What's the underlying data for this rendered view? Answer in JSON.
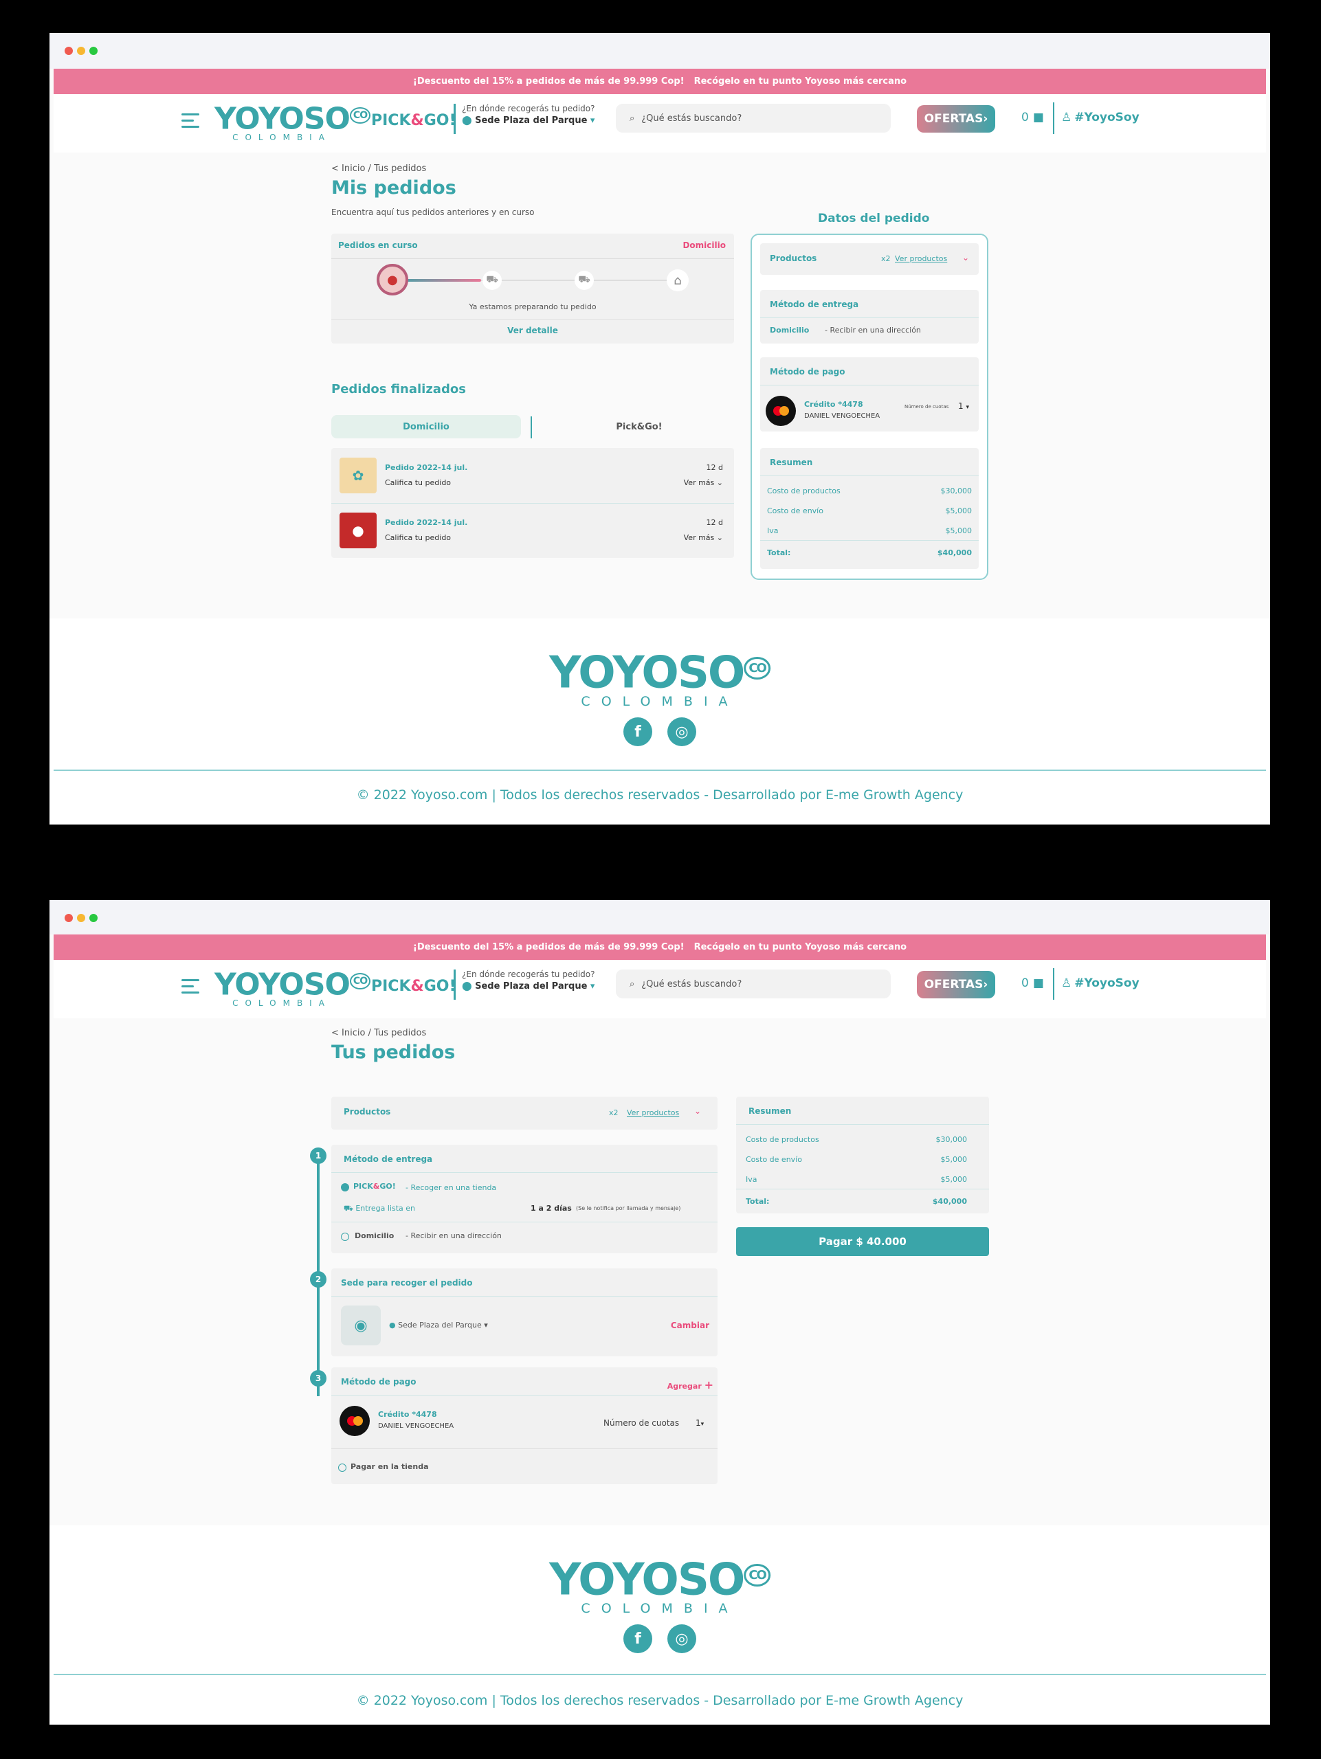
{
  "header": {
    "promo1": "¡Descuento del 15% a pedidos de más de 99.999 Cop!",
    "promo2": "Recógelo en tu punto Yoyoso más cercano",
    "logo_word": "YOYOSO",
    "logo_co": "CO",
    "logo_country": "COLOMBIA",
    "pick": "PICK",
    "amp": "&",
    "go": "GO!",
    "where_q": "¿En dónde recogerás tu pedido?",
    "where_store": "Sede Plaza del Parque",
    "search_placeholder": "¿Qué estás buscando?",
    "ofertas": "OFERTAS",
    "cart_count": "0",
    "user": "#YoyoSoy"
  },
  "screen1": {
    "breadcrumb": "< Inicio / Tus pedidos",
    "title": "Mis pedidos",
    "subtitle": "Encuentra aquí tus pedidos anteriores y en curso",
    "current": {
      "label": "Pedidos en curso",
      "type": "Domicilio",
      "status": "Ya estamos preparando tu pedido",
      "detail": "Ver detalle"
    },
    "finished_title": "Pedidos finalizados",
    "tab_home": "Domicilio",
    "tab_pick": "Pick&Go!",
    "orders": [
      {
        "name": "Pedido 2022-14 jul.",
        "rate": "Califica tu pedido",
        "days": "12 d",
        "more": "Ver más"
      },
      {
        "name": "Pedido 2022-14 jul.",
        "rate": "Califica tu pedido",
        "days": "12 d",
        "more": "Ver más"
      }
    ],
    "panel": {
      "title": "Datos del pedido",
      "products": "Productos",
      "qty": "x2",
      "see": "Ver productos",
      "delivery_title": "Método de entrega",
      "delivery_type": "Domicilio",
      "delivery_desc": "- Recibir en una dirección",
      "pay_title": "Método de pago",
      "card": "Crédito *4478",
      "holder": "DANIEL VENGOECHEA",
      "installments_label": "Número de cuotas",
      "installments": "1",
      "summary": "Resumen",
      "rows": [
        [
          "Costo de productos",
          "$30,000"
        ],
        [
          "Costo de envío",
          "$5,000"
        ],
        [
          "Iva",
          "$5,000"
        ],
        [
          "Total:",
          "$40,000"
        ]
      ]
    }
  },
  "screen2": {
    "breadcrumb": "< Inicio / Tus pedidos",
    "title": "Tus pedidos",
    "products": "Productos",
    "qty": "x2",
    "see": "Ver productos",
    "steps": [
      "1",
      "2",
      "3"
    ],
    "delivery_title": "Método de entrega",
    "pick_desc": "- Recoger en una tienda",
    "ready": "Entrega lista en",
    "ready_days": "1 a 2 días",
    "notify": "(Se le notifica por llamada y mensaje)",
    "home": "Domicilio",
    "home_desc": "- Recibir en una dirección",
    "store_title": "Sede para recoger el pedido",
    "store": "Sede Plaza del Parque",
    "change": "Cambiar",
    "pay_title": "Método de pago",
    "add": "Agregar",
    "card": "Crédito *4478",
    "holder": "DANIEL VENGOECHEA",
    "installments_label": "Número de cuotas",
    "installments": "1",
    "pay_store": "Pagar en la tienda",
    "summary": "Resumen",
    "rows": [
      [
        "Costo de productos",
        "$30,000"
      ],
      [
        "Costo de envío",
        "$5,000"
      ],
      [
        "Iva",
        "$5,000"
      ],
      [
        "Total:",
        "$40,000"
      ]
    ],
    "pay_button": "Pagar $ 40.000"
  },
  "footer": {
    "copyright": "© 2022 Yoyoso.com | Todos los derechos reservados - Desarrollado por E-me Growth Agency",
    "facebook": "f",
    "instagram": "◎"
  }
}
